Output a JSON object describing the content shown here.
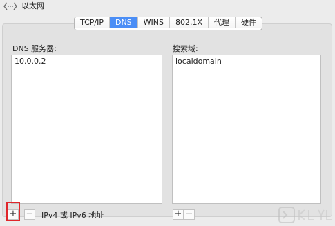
{
  "window": {
    "title": "以太网",
    "nav_icon": "chevron-left-dots-right-icon"
  },
  "tabs": [
    {
      "label": "TCP/IP",
      "active": false
    },
    {
      "label": "DNS",
      "active": true
    },
    {
      "label": "WINS",
      "active": false
    },
    {
      "label": "802.1X",
      "active": false
    },
    {
      "label": "代理",
      "active": false
    },
    {
      "label": "硬件",
      "active": false
    }
  ],
  "dns_servers": {
    "label": "DNS 服务器:",
    "items": [
      "10.0.0.2"
    ],
    "add_label": "+",
    "remove_label": "−",
    "hint": "IPv4 或 IPv6 地址"
  },
  "search_domains": {
    "label": "搜索域:",
    "items": [
      "localdomain"
    ],
    "add_label": "+",
    "remove_label": "−"
  },
  "colors": {
    "accent": "#4b8ef6",
    "highlight_frame": "#e0262b",
    "background": "#ececec"
  }
}
